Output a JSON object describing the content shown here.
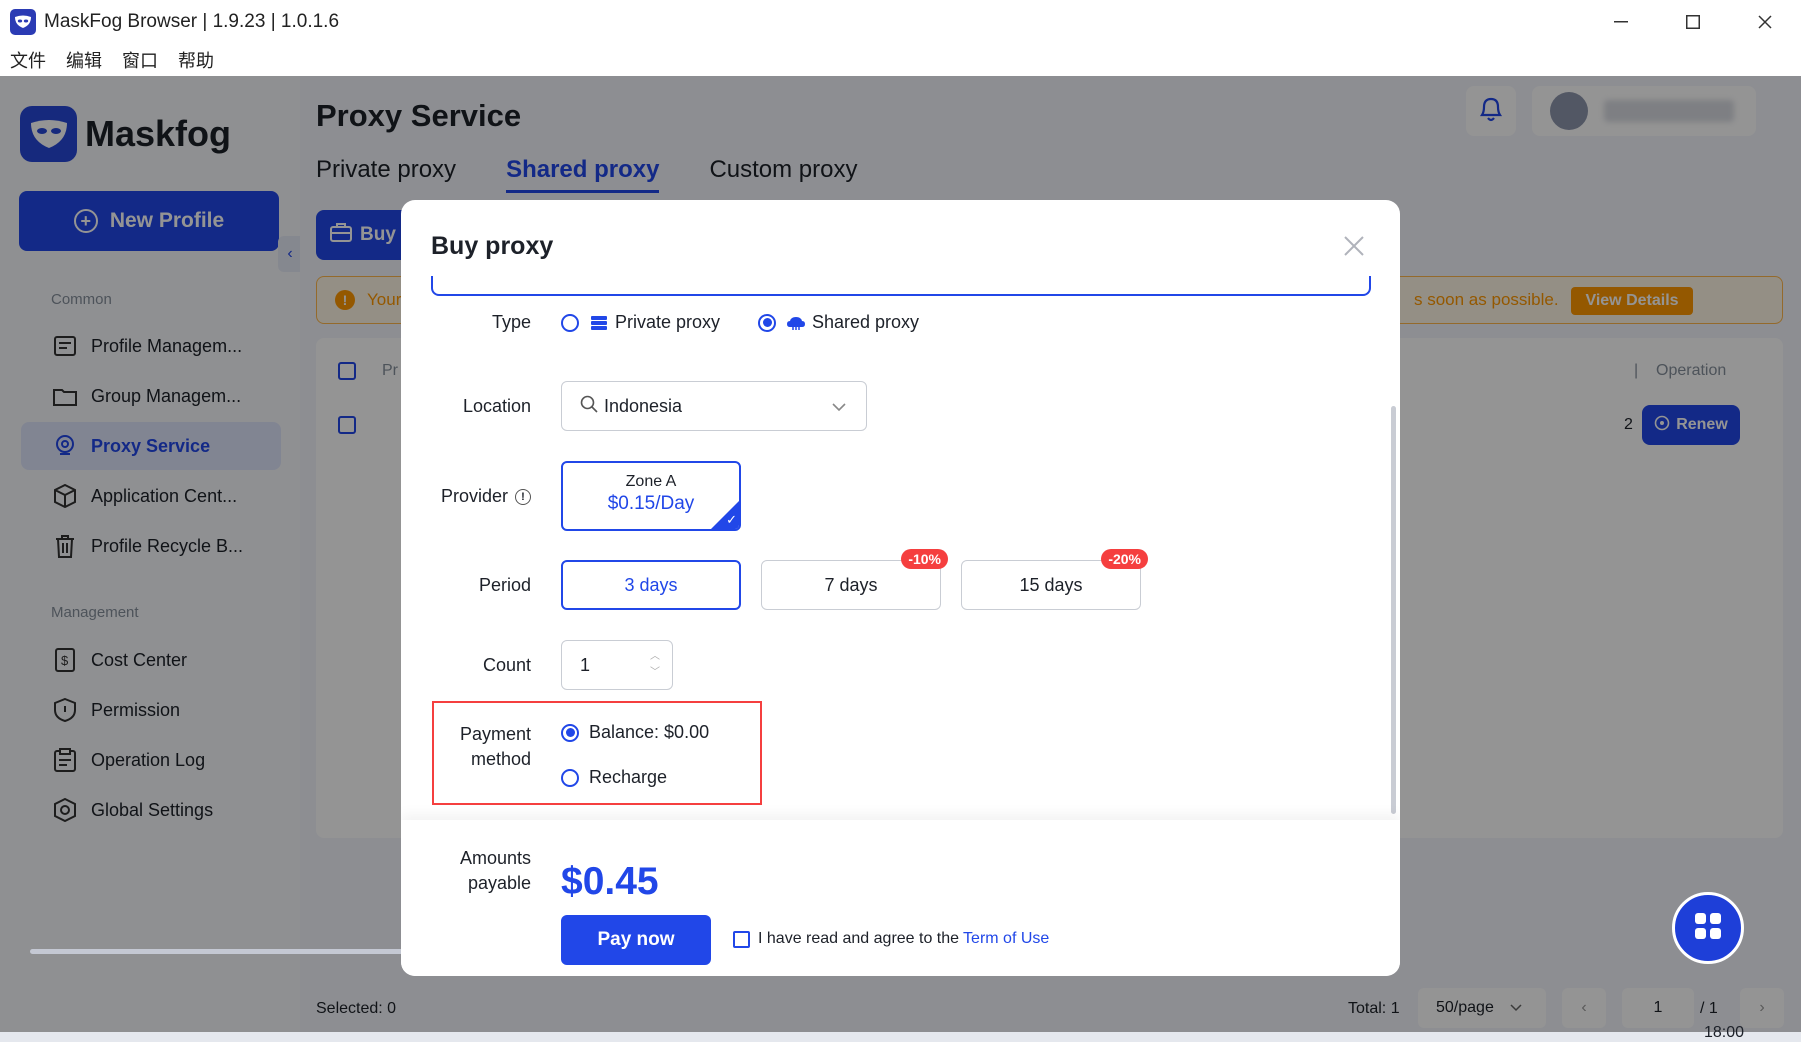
{
  "window": {
    "title": "MaskFog Browser | 1.9.23 | 1.0.1.6",
    "controls": [
      "minimize",
      "maximize",
      "close"
    ]
  },
  "menu": [
    "文件",
    "编辑",
    "窗口",
    "帮助"
  ],
  "sidebar": {
    "logo": "Maskfog",
    "new_profile": "New Profile",
    "section_common": "Common",
    "common_items": [
      {
        "label": "Profile Managem...",
        "icon": "profile-icon"
      },
      {
        "label": "Group Managem...",
        "icon": "folder-icon"
      },
      {
        "label": "Proxy Service",
        "icon": "location-pin-icon",
        "active": true
      },
      {
        "label": "Application Cent...",
        "icon": "cube-icon"
      },
      {
        "label": "Profile Recycle B...",
        "icon": "trash-icon"
      }
    ],
    "section_management": "Management",
    "management_items": [
      {
        "label": "Cost Center",
        "icon": "receipt-icon"
      },
      {
        "label": "Permission",
        "icon": "shield-icon"
      },
      {
        "label": "Operation Log",
        "icon": "clipboard-icon"
      },
      {
        "label": "Global Settings",
        "icon": "settings-icon"
      }
    ]
  },
  "main": {
    "title": "Proxy Service",
    "tabs": [
      {
        "label": "Private proxy",
        "active": false
      },
      {
        "label": "Shared proxy",
        "active": true
      },
      {
        "label": "Custom proxy",
        "active": false
      }
    ],
    "buy_button": "Buy",
    "notice_left": "Your",
    "notice_right": "s soon as possible.",
    "view_details": "View Details",
    "table": {
      "header_partial": "Pr",
      "operation_header": "Operation",
      "renew": "Renew",
      "row_partial": "2"
    },
    "footer": {
      "selected": "Selected: 0",
      "total": "Total: 1",
      "page_size": "50/page",
      "current_page": "1",
      "page_total": "/ 1"
    }
  },
  "modal": {
    "title": "Buy proxy",
    "type_label": "Type",
    "type_options": [
      {
        "label": "Private proxy",
        "selected": false,
        "icon": "server-icon"
      },
      {
        "label": "Shared proxy",
        "selected": true,
        "icon": "cloud-icon"
      }
    ],
    "location_label": "Location",
    "location_value": "Indonesia",
    "provider_label": "Provider",
    "provider_card": {
      "name": "Zone A",
      "price": "$0.15/Day",
      "selected": true
    },
    "period_label": "Period",
    "periods": [
      {
        "label": "3 days",
        "selected": true,
        "discount": ""
      },
      {
        "label": "7 days",
        "selected": false,
        "discount": "-10%"
      },
      {
        "label": "15 days",
        "selected": false,
        "discount": "-20%"
      }
    ],
    "count_label": "Count",
    "count_value": "1",
    "payment_label_1": "Payment",
    "payment_label_2": "method",
    "payment_options": [
      {
        "label": "Balance: $0.00",
        "selected": true
      },
      {
        "label": "Recharge",
        "selected": false
      }
    ],
    "amount_label_1": "Amounts",
    "amount_label_2": "payable",
    "amount": "$0.45",
    "pay_now": "Pay now",
    "agree_text": "I have read and agree to the",
    "terms_link": "Term of Use"
  },
  "taskbar": {
    "time": "18:00"
  },
  "colors": {
    "accent": "#2147e8",
    "warning": "#ff9800",
    "danger": "#f53f3f"
  }
}
